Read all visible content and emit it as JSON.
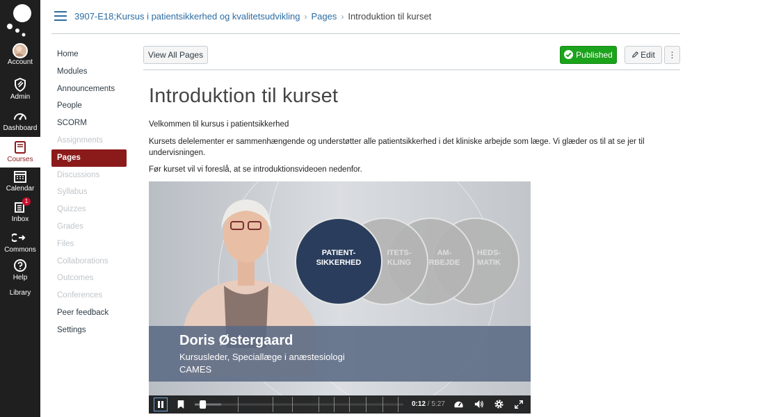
{
  "global_nav": {
    "account": "Account",
    "admin": "Admin",
    "dashboard": "Dashboard",
    "courses": "Courses",
    "calendar": "Calendar",
    "inbox": "Inbox",
    "inbox_badge": "1",
    "commons": "Commons",
    "help": "Help",
    "library": "Library"
  },
  "breadcrumb": {
    "course": "3907-E18;Kursus i patientsikkerhed og kvalitetsudvikling",
    "section": "Pages",
    "current": "Introduktion til kurset",
    "sep1": "›",
    "sep2": "›"
  },
  "course_nav": [
    {
      "label": "Home",
      "state": "normal"
    },
    {
      "label": "Modules",
      "state": "normal"
    },
    {
      "label": "Announcements",
      "state": "normal"
    },
    {
      "label": "People",
      "state": "normal"
    },
    {
      "label": "SCORM",
      "state": "normal"
    },
    {
      "label": "Assignments",
      "state": "disabled"
    },
    {
      "label": "Pages",
      "state": "active"
    },
    {
      "label": "Discussions",
      "state": "disabled"
    },
    {
      "label": "Syllabus",
      "state": "disabled"
    },
    {
      "label": "Quizzes",
      "state": "disabled"
    },
    {
      "label": "Grades",
      "state": "disabled"
    },
    {
      "label": "Files",
      "state": "disabled"
    },
    {
      "label": "Collaborations",
      "state": "disabled"
    },
    {
      "label": "Outcomes",
      "state": "disabled"
    },
    {
      "label": "Conferences",
      "state": "disabled"
    },
    {
      "label": "Peer feedback",
      "state": "normal"
    },
    {
      "label": "Settings",
      "state": "normal"
    }
  ],
  "toolbar": {
    "view_all": "View All Pages",
    "published": "Published",
    "edit": "Edit",
    "more": "⋮"
  },
  "page": {
    "title": "Introduktion til kurset",
    "p1": "Velkommen til kursus i patientsikkerhed",
    "p2": "Kursets delelementer er sammenhængende og understøtter alle patientsikkerhed i det kliniske arbejde som læge. Vi glæder os til at se jer til undervisningen.",
    "p3": "Før kurset vil vi foreslå, at se introduktionsvideoen nedenfor."
  },
  "video": {
    "circle1_line1": "PATIENT-",
    "circle1_line2": "SIKKERHED",
    "circle2_line1": "ITETS-",
    "circle2_line2": "KLING",
    "circle3_line1": "AM-",
    "circle3_line2": "RBEJDE",
    "circle4_line1": "HEDS-",
    "circle4_line2": "MATIK",
    "name": "Doris Østergaard",
    "role": "Kursusleder, Speciallæge i anæstesiologi",
    "org": "CAMES",
    "current_time": "0:12",
    "time_sep": " / ",
    "duration": "5:27",
    "progress": 0.037
  },
  "colors": {
    "nav_bg": "#1f1f1f",
    "course_active": "#8b1a1a",
    "published": "#1ca31c",
    "link": "#2b6ca3"
  }
}
